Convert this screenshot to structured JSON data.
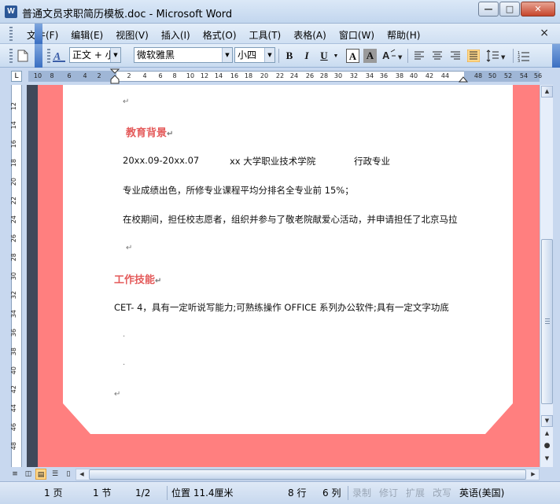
{
  "window": {
    "title": "普通文员求职简历模板.doc - Microsoft Word",
    "app_icon": "W",
    "minimize": "—",
    "maximize": "□",
    "close": "✕"
  },
  "menu": {
    "items": [
      "文件(F)",
      "编辑(E)",
      "视图(V)",
      "插入(I)",
      "格式(O)",
      "工具(T)",
      "表格(A)",
      "窗口(W)",
      "帮助(H)"
    ],
    "doc_close": "×"
  },
  "toolbar": {
    "style_value": "正文 + 小四",
    "font_value": "微软雅黑",
    "size_value": "小四",
    "bold": "B",
    "italic": "I",
    "underline": "U",
    "font_color_letter": "A",
    "char_shading_letter": "A"
  },
  "ruler": {
    "tab_selector": "L",
    "h_numbers": [
      "10",
      "8",
      "6",
      "4",
      "2",
      "2",
      "4",
      "6",
      "8",
      "10",
      "12",
      "14",
      "16",
      "18",
      "20",
      "22",
      "24",
      "26",
      "28",
      "30",
      "32",
      "34",
      "36",
      "38",
      "40",
      "42",
      "44",
      "48",
      "50",
      "52",
      "54",
      "56"
    ],
    "v_numbers": [
      "12",
      "14",
      "16",
      "18",
      "20",
      "22",
      "24",
      "26",
      "28",
      "30",
      "32",
      "34",
      "36",
      "38",
      "40",
      "42",
      "44",
      "46",
      "48"
    ]
  },
  "document": {
    "para_mark": "↵",
    "education_heading": "教育背景",
    "edu_dates": "20xx.09-20xx.07",
    "edu_school": "xx 大学职业技术学院",
    "edu_major": "行政专业",
    "edu_line2": "专业成绩出色，所修专业课程平均分排名全专业前 15%；",
    "edu_line3": "在校期间，担任校志愿者，组织并参与了敬老院献爱心活动，并申请担任了北京马拉",
    "skills_heading": "工作技能",
    "skills_line": "CET- 4，具有一定听说写能力;可熟练操作 OFFICE 系列办公软件;具有一定文字功底"
  },
  "statusbar": {
    "page": "1 页",
    "section": "1 节",
    "page_of": "1/2",
    "position": "位置 11.4厘米",
    "line": "8 行",
    "column": "6 列",
    "rec": "录制",
    "trk": "修订",
    "ext": "扩展",
    "ovr": "改写",
    "language": "英语(美国)"
  }
}
